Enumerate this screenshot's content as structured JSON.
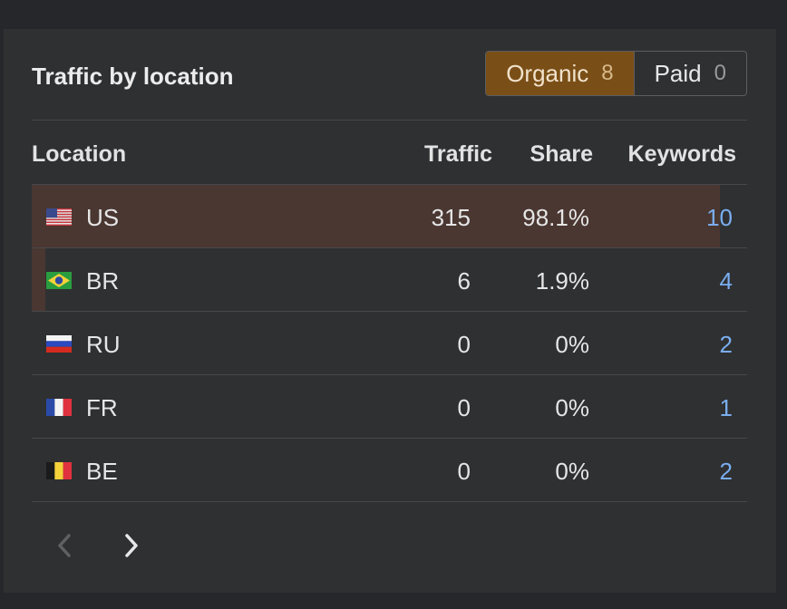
{
  "widget": {
    "title": "Traffic by location",
    "toggle": [
      {
        "label": "Organic",
        "count": "8",
        "active": true
      },
      {
        "label": "Paid",
        "count": "0",
        "active": false
      }
    ]
  },
  "table": {
    "headers": {
      "location": "Location",
      "traffic": "Traffic",
      "share": "Share",
      "keywords": "Keywords"
    },
    "rows": [
      {
        "country": "US",
        "flag": "us-flag-icon",
        "traffic": "315",
        "share": "98.1%",
        "keywords": "10",
        "share_fraction": 0.981
      },
      {
        "country": "BR",
        "flag": "br-flag-icon",
        "traffic": "6",
        "share": "1.9%",
        "keywords": "4",
        "share_fraction": 0.019
      },
      {
        "country": "RU",
        "flag": "ru-flag-icon",
        "traffic": "0",
        "share": "0%",
        "keywords": "2",
        "share_fraction": 0
      },
      {
        "country": "FR",
        "flag": "fr-flag-icon",
        "traffic": "0",
        "share": "0%",
        "keywords": "1",
        "share_fraction": 0
      },
      {
        "country": "BE",
        "flag": "be-flag-icon",
        "traffic": "0",
        "share": "0%",
        "keywords": "2",
        "share_fraction": 0
      }
    ]
  },
  "pagination": {
    "prev_enabled": false,
    "next_enabled": true
  },
  "colors": {
    "accent": "#7a4f17",
    "link": "#7aaef0",
    "share_bar": "#4a3731"
  }
}
